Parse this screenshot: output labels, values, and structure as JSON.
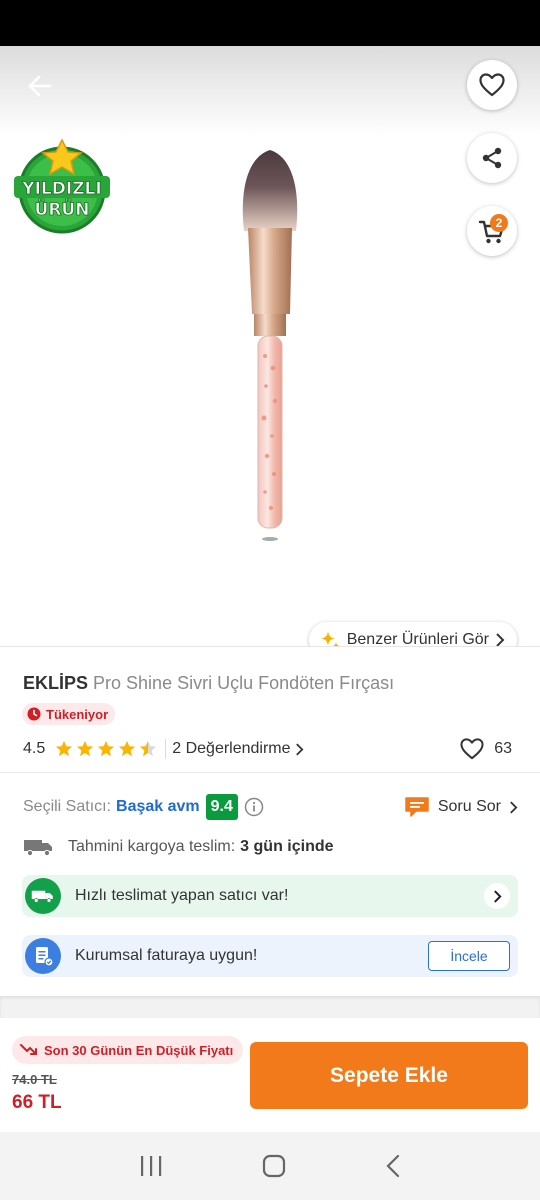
{
  "colors": {
    "accent": "#f27a1a",
    "danger": "#d21e26",
    "seller_link": "#1f6ad4",
    "score_green": "#0a9b3f",
    "star": "#fbb400"
  },
  "badge": {
    "line1": "YILDIZLI",
    "line2": "ÜRÜN"
  },
  "cart": {
    "count": "2"
  },
  "similar": {
    "label": "Benzer Ürünleri Gör"
  },
  "product": {
    "brand": "EKLİPS",
    "name": "Pro Shine Sivri Uçlu Fondöten Fırçası",
    "stock_status": "Tükeniyor",
    "rating": "4.5",
    "rating_stars": 4.5,
    "review_link": "2 Değerlendirme",
    "like_count": "63"
  },
  "seller": {
    "label": "Seçili Satıcı:",
    "name": "Başak avm",
    "score": "9.4",
    "ask_label": "Soru Sor"
  },
  "delivery": {
    "label": "Tahmini kargoya teslim:",
    "value": "3 gün içinde"
  },
  "fast_delivery": {
    "text": "Hızlı teslimat yapan satıcı var!"
  },
  "corporate": {
    "text": "Kurumsal faturaya uygun!",
    "button": "İncele"
  },
  "price": {
    "badge": "Son 30 Günün En Düşük Fiyatı",
    "old": "74.0 TL",
    "new": "66 TL",
    "cta": "Sepete Ekle"
  }
}
